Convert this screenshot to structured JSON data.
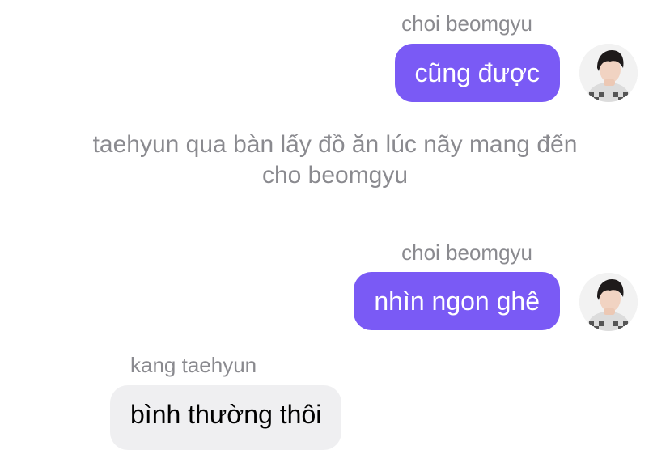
{
  "conversation": {
    "messages": [
      {
        "sender": "choi beomgyu",
        "text": "cũng được",
        "side": "right",
        "avatar_icon": "user-avatar-icon"
      },
      {
        "narration": "taehyun qua bàn lấy đồ ăn lúc nãy mang đến cho beomgyu"
      },
      {
        "sender": "choi beomgyu",
        "text": "nhìn ngon ghê",
        "side": "right",
        "avatar_icon": "user-avatar-icon"
      },
      {
        "sender": "kang taehyun",
        "text": "bình thường thôi",
        "side": "left"
      }
    ]
  },
  "colors": {
    "sent_bubble": "#7a5af5",
    "received_bubble": "#efeff1",
    "meta_text": "#8a8a8f"
  }
}
